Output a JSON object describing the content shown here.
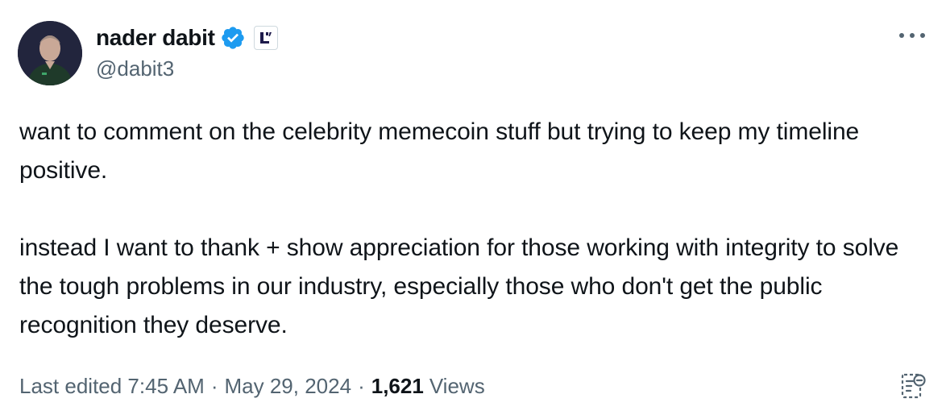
{
  "author": {
    "display_name": "nader dabit",
    "handle": "@dabit3"
  },
  "tweet": {
    "paragraphs": [
      "want to comment on the celebrity memecoin stuff but trying to keep my timeline positive.",
      "instead I want to thank + show appreciation for those working with integrity to solve the tough problems in our industry, especially those who don't get the public recognition they deserve."
    ]
  },
  "meta": {
    "edited_prefix": "Last edited 7:45 AM",
    "separator": "·",
    "date": "May 29, 2024",
    "views_count": "1,621",
    "views_label": "Views"
  },
  "colors": {
    "verified_blue": "#1d9bf0",
    "secondary_text": "#536471",
    "primary_text": "#0f1419"
  },
  "icons": {
    "verified": "verified-badge-icon",
    "affiliate": "affiliate-badge-icon",
    "more": "more-options-icon",
    "edit_history": "edit-history-icon"
  }
}
